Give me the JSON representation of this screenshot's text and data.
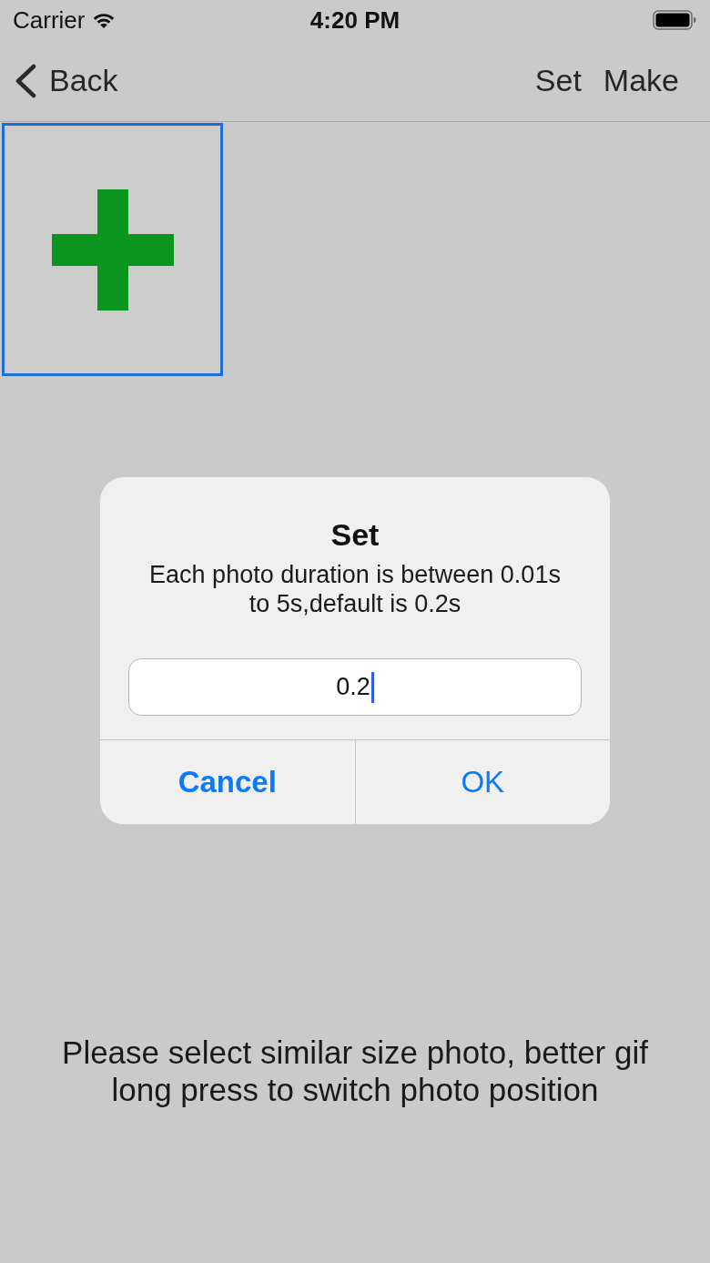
{
  "status_bar": {
    "carrier": "Carrier",
    "time": "4:20 PM"
  },
  "nav_bar": {
    "back": "Back",
    "actions": [
      "Set",
      "Make"
    ]
  },
  "photos": [
    {
      "kind": "add"
    }
  ],
  "hint": {
    "lines": [
      "Please select similar size photo, better gif",
      "long press to switch photo position"
    ]
  },
  "dialog": {
    "title": "Set",
    "message": "Each photo duration is between 0.01s to 5s,default is 0.2s",
    "input": {
      "value": "0.2",
      "focused": true
    },
    "buttons": [
      {
        "label": "Cancel",
        "kind": "cancel"
      },
      {
        "label": "OK",
        "kind": "default"
      }
    ]
  }
}
